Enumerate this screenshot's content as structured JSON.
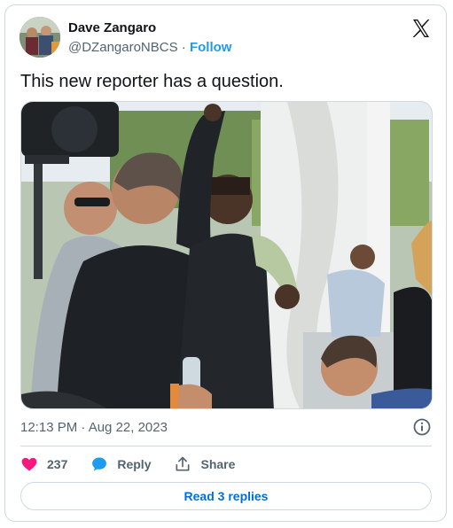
{
  "author": {
    "name": "Dave Zangaro",
    "handle": "@DZangaroNBCS",
    "separator": "·",
    "follow_label": "Follow"
  },
  "tweet": {
    "text": "This new reporter has a question.",
    "timestamp": "12:13 PM · Aug 22, 2023"
  },
  "icons": {
    "brand": "x-logo-icon",
    "info": "info-icon",
    "like": "heart-icon",
    "reply": "speech-bubble-icon",
    "share": "share-upload-icon"
  },
  "actions": {
    "likes": "237",
    "reply_label": "Reply",
    "share_label": "Share"
  },
  "read_replies_label": "Read 3 replies",
  "colors": {
    "accent": "#1d9bf0",
    "like": "#f91880",
    "text": "#0f1419",
    "muted": "#536471",
    "border": "#cfd9de"
  }
}
